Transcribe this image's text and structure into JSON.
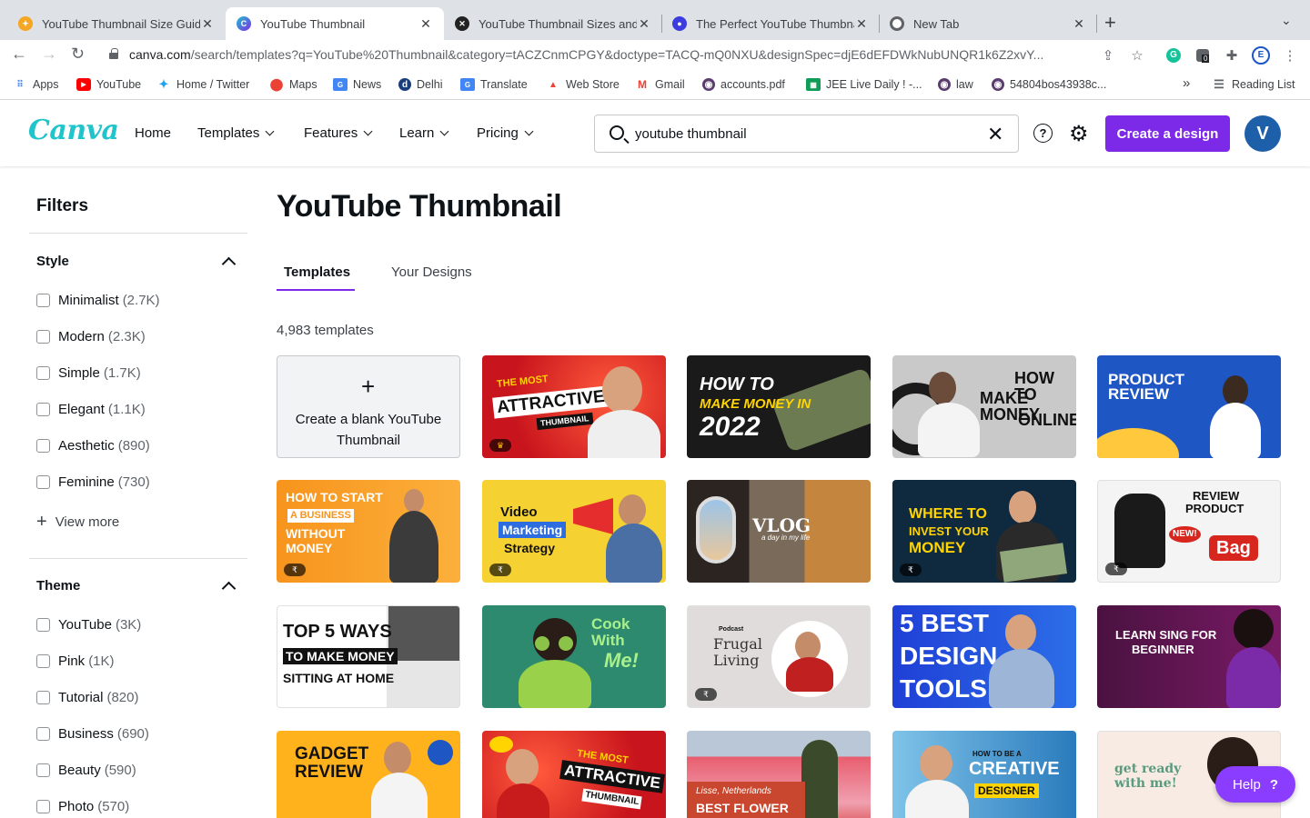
{
  "browser": {
    "tabs": [
      {
        "title": "YouTube Thumbnail Size Guide",
        "icon": "tubics-icon"
      },
      {
        "title": "YouTube Thumbnail",
        "icon": "canva-icon"
      },
      {
        "title": "YouTube Thumbnail Sizes and B",
        "icon": "squarespace-icon"
      },
      {
        "title": "The Perfect YouTube Thumbnai",
        "icon": "blue-dot-icon"
      },
      {
        "title": "New Tab",
        "icon": "chrome-icon"
      }
    ],
    "url_host": "canva.com",
    "url_path": "/search/templates?q=YouTube%20Thumbnail&category=tACZCnmCPGY&doctype=TACQ-mQ0NXU&designSpec=djE6dEFDWkNubUNQR1k6Z2xvY...",
    "extension_badge": "0",
    "profile_letter": "E",
    "bookmarks": [
      "Apps",
      "YouTube",
      "Home / Twitter",
      "Maps",
      "News",
      "Delhi",
      "Translate",
      "Web Store",
      "Gmail",
      "accounts.pdf",
      "JEE Live Daily ! -...",
      "law",
      "54804bos43938c..."
    ],
    "more_bookmarks": "»",
    "reading_list": "Reading List"
  },
  "header": {
    "logo": "Canva",
    "nav": [
      "Home",
      "Templates",
      "Features",
      "Learn",
      "Pricing"
    ],
    "search_value": "youtube thumbnail",
    "create_label": "Create a design",
    "avatar_letter": "V",
    "help_glyph": "?",
    "brand_color": "#7d2ae8"
  },
  "filters": {
    "title": "Filters",
    "style": {
      "title": "Style",
      "items": [
        {
          "label": "Minimalist",
          "count": "(2.7K)"
        },
        {
          "label": "Modern",
          "count": "(2.3K)"
        },
        {
          "label": "Simple",
          "count": "(1.7K)"
        },
        {
          "label": "Elegant",
          "count": "(1.1K)"
        },
        {
          "label": "Aesthetic",
          "count": "(890)"
        },
        {
          "label": "Feminine",
          "count": "(730)"
        }
      ],
      "view_more": "View more"
    },
    "theme": {
      "title": "Theme",
      "items": [
        {
          "label": "YouTube",
          "count": "(3K)"
        },
        {
          "label": "Pink",
          "count": "(1K)"
        },
        {
          "label": "Tutorial",
          "count": "(820)"
        },
        {
          "label": "Business",
          "count": "(690)"
        },
        {
          "label": "Beauty",
          "count": "(590)"
        },
        {
          "label": "Photo",
          "count": "(570)"
        }
      ]
    }
  },
  "main": {
    "title": "YouTube Thumbnail",
    "tabs": [
      "Templates",
      "Your Designs"
    ],
    "count": "4,983 templates",
    "blank_card": "Create a blank YouTube Thumbnail",
    "thumbnails": [
      {
        "lines": [
          "THE MOST",
          "ATTRACTIVE",
          "THUMBNAIL"
        ]
      },
      {
        "lines": [
          "HOW TO",
          "MAKE MONEY IN",
          "2022"
        ]
      },
      {
        "lines": [
          "HOW TO",
          "MAKE MONEY",
          "ONLINE"
        ]
      },
      {
        "lines": [
          "PRODUCT",
          "REVIEW"
        ]
      },
      {
        "lines": [
          "HOW TO START",
          "A BUSINESS",
          "WITHOUT",
          "MONEY"
        ]
      },
      {
        "lines": [
          "Video",
          "Marketing",
          "Strategy"
        ]
      },
      {
        "lines": [
          "VLOG",
          "a day in my life"
        ]
      },
      {
        "lines": [
          "WHERE TO",
          "INVEST YOUR",
          "MONEY"
        ]
      },
      {
        "lines": [
          "REVIEW",
          "PRODUCT",
          "NEW!",
          "Bag"
        ]
      },
      {
        "lines": [
          "TOP 5 WAYS",
          "TO MAKE MONEY",
          "SITTING AT HOME"
        ]
      },
      {
        "lines": [
          "Cook",
          "With",
          "Me!"
        ]
      },
      {
        "lines": [
          "Podcast",
          "Frugal",
          "Living"
        ]
      },
      {
        "lines": [
          "5 BEST",
          "DESIGN",
          "TOOLS"
        ]
      },
      {
        "lines": [
          "LEARN SING FOR",
          "BEGINNER"
        ]
      },
      {
        "lines": [
          "GADGET",
          "REVIEW"
        ]
      },
      {
        "lines": [
          "THE MOST",
          "ATTRACTIVE",
          "THUMBNAIL"
        ]
      },
      {
        "lines": [
          "Lisse, Netherlands",
          "BEST FLOWER"
        ]
      },
      {
        "lines": [
          "HOW TO BE A",
          "CREATIVE",
          "DESIGNER"
        ]
      },
      {
        "lines": [
          "get ready",
          "with me!"
        ]
      }
    ],
    "pro_badge": "₹"
  },
  "help_fab": {
    "label": "Help",
    "glyph": "?"
  }
}
